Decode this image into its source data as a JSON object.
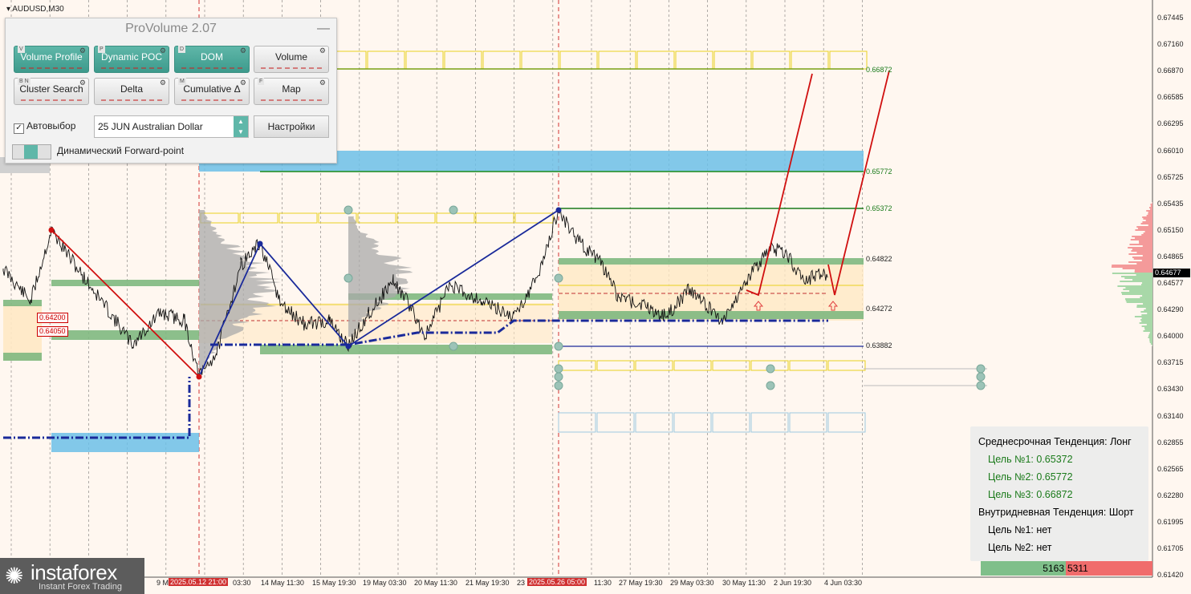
{
  "symbol": "AUDUSD,M30",
  "panel": {
    "title": "ProVolume 2.07",
    "minimize_icon": "—",
    "buttons": [
      {
        "key": "V",
        "label": "Volume Profile",
        "active": true
      },
      {
        "key": "P",
        "label": "Dynamic POC",
        "active": true
      },
      {
        "key": "D",
        "label": "DOM",
        "active": true
      },
      {
        "key": "",
        "label": "Volume",
        "active": false
      },
      {
        "key": "B",
        "key2": "N",
        "label": "Cluster Search",
        "active": false
      },
      {
        "key": "",
        "label": "Delta",
        "active": false
      },
      {
        "key": "M",
        "label": "Cumulative Δ",
        "active": false
      },
      {
        "key": "F",
        "label": "Map",
        "active": false
      }
    ],
    "autoselect_label": "Автовыбор",
    "instrument": "25 JUN Australian Dollar",
    "settings_label": "Настройки",
    "forward_label": "Динамический Forward-point"
  },
  "price_axis": [
    "0.67445",
    "0.67160",
    "0.66870",
    "0.66585",
    "0.66295",
    "0.66010",
    "0.65725",
    "0.65435",
    "0.65150",
    "0.64865",
    "0.64577",
    "0.64290",
    "0.64000",
    "0.63715",
    "0.63430",
    "0.63140",
    "0.62855",
    "0.62565",
    "0.62280",
    "0.61995",
    "0.61705",
    "0.61420"
  ],
  "current_price": "0.64677",
  "level_labels": [
    {
      "text": "0.66872",
      "color": "#1a7a1a"
    },
    {
      "text": "0.65772",
      "color": "#1a7a1a"
    },
    {
      "text": "0.65372",
      "color": "#1a7a1a"
    },
    {
      "text": "0.64822",
      "color": "#222"
    },
    {
      "text": "0.64272",
      "color": "#222"
    },
    {
      "text": "0.63882",
      "color": "#222"
    }
  ],
  "left_levels": [
    "0.64200",
    "0.64050"
  ],
  "time_axis": [
    "9 M",
    "14 May 11:30",
    "15 May 19:30",
    "19 May 03:30",
    "20 May 11:30",
    "21 May 19:30",
    "23",
    "27 May 19:30",
    "29 May 03:30",
    "30 May 11:30",
    "2 Jun 19:30",
    "4 Jun 03:30"
  ],
  "time_highlights": [
    "2025.05.12 21:00",
    "2025.05.26 05:00"
  ],
  "time_extra": [
    "03:30",
    "11:30"
  ],
  "trend": {
    "mid_title": "Среднесрочная Тенденция: Лонг",
    "targets": [
      "Цель №1: 0.65372",
      "Цель №2: 0.65772",
      "Цель №3: 0.66872"
    ],
    "intra_title": "Внутридневная Тенденция: Шорт",
    "intra_targets": [
      "Цель №1: нет",
      "Цель №2: нет"
    ]
  },
  "volume_bar": {
    "buy": "5163",
    "sell": "5311"
  },
  "logo": {
    "name": "instaforex",
    "tagline": "Instant Forex Trading"
  },
  "colors": {
    "accent": "#5fb7a9",
    "red": "#d01010",
    "blue": "#1a2a9a",
    "green_zone": "#7fb87f",
    "blue_zone": "#6cc0e8"
  }
}
